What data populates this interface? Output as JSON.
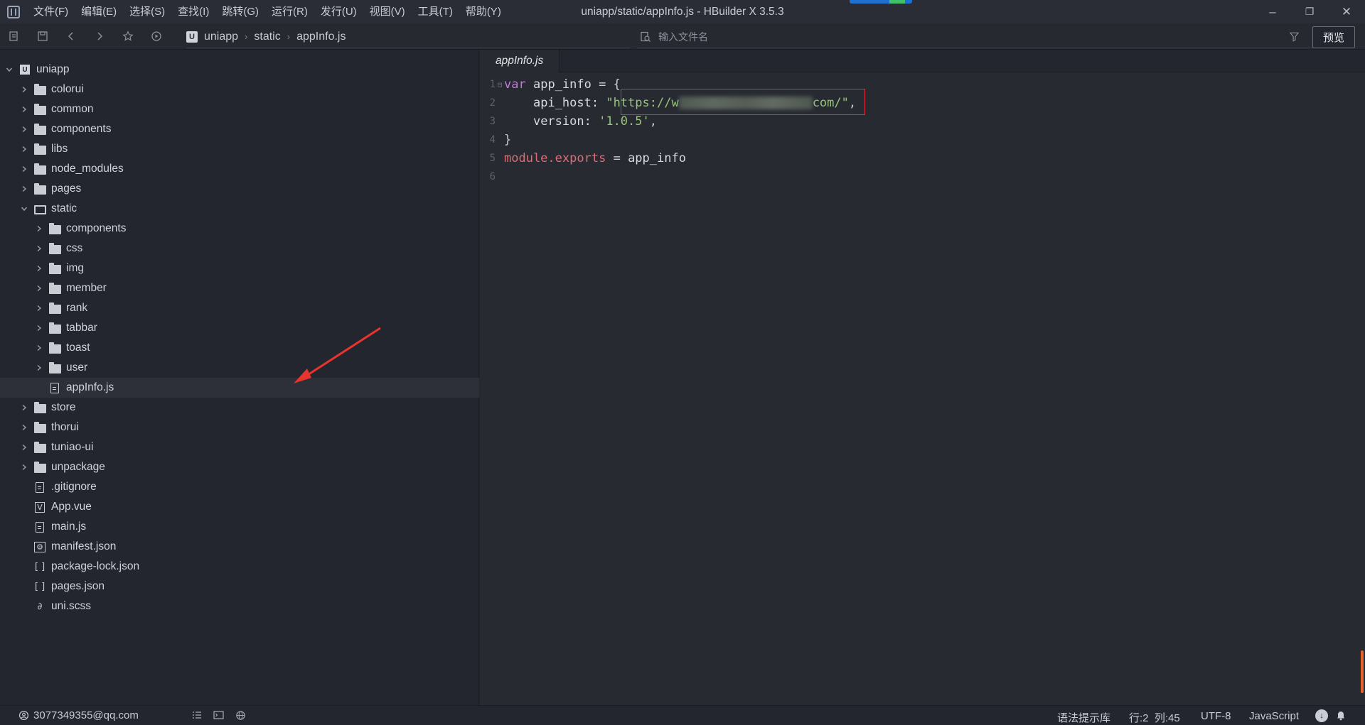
{
  "window": {
    "title": "uniapp/static/appInfo.js - HBuilder X 3.5.3",
    "menu": [
      "文件(F)",
      "编辑(E)",
      "选择(S)",
      "查找(I)",
      "跳转(G)",
      "运行(R)",
      "发行(U)",
      "视图(V)",
      "工具(T)",
      "帮助(Y)"
    ],
    "controls": {
      "minimize": "–",
      "maximize": "❐",
      "close": "✕"
    }
  },
  "toolbar": {
    "breadcrumb": [
      "uniapp",
      "static",
      "appInfo.js"
    ],
    "breadcrumb_logo": "U",
    "file_search_placeholder": "输入文件名",
    "preview_label": "预览"
  },
  "sidebar": {
    "root": "uniapp",
    "root_logo": "U",
    "items": [
      {
        "label": "colorui",
        "type": "folder"
      },
      {
        "label": "common",
        "type": "folder"
      },
      {
        "label": "components",
        "type": "folder"
      },
      {
        "label": "libs",
        "type": "folder"
      },
      {
        "label": "node_modules",
        "type": "folder"
      },
      {
        "label": "pages",
        "type": "folder"
      },
      {
        "label": "static",
        "type": "folder-open"
      },
      {
        "label": "components",
        "type": "folder"
      },
      {
        "label": "css",
        "type": "folder"
      },
      {
        "label": "img",
        "type": "folder"
      },
      {
        "label": "member",
        "type": "folder"
      },
      {
        "label": "rank",
        "type": "folder"
      },
      {
        "label": "tabbar",
        "type": "folder"
      },
      {
        "label": "toast",
        "type": "folder"
      },
      {
        "label": "user",
        "type": "folder"
      },
      {
        "label": "appInfo.js",
        "type": "file-js",
        "selected": true
      },
      {
        "label": "store",
        "type": "folder"
      },
      {
        "label": "thorui",
        "type": "folder"
      },
      {
        "label": "tuniao-ui",
        "type": "folder"
      },
      {
        "label": "unpackage",
        "type": "folder"
      },
      {
        "label": ".gitignore",
        "type": "file"
      },
      {
        "label": "App.vue",
        "type": "file-vue",
        "glyph": "V"
      },
      {
        "label": "main.js",
        "type": "file-js"
      },
      {
        "label": "manifest.json",
        "type": "file-manifest",
        "glyph": "⚙"
      },
      {
        "label": "package-lock.json",
        "type": "file-json",
        "glyph": "[ ]"
      },
      {
        "label": "pages.json",
        "type": "file-json",
        "glyph": "[ ]"
      },
      {
        "label": "uni.scss",
        "type": "file-scss",
        "glyph": "∂"
      }
    ]
  },
  "editor": {
    "tab": "appInfo.js",
    "line_numbers": [
      "1",
      "2",
      "3",
      "4",
      "5",
      "6"
    ],
    "code": {
      "l1_kw": "var",
      "l1_id": "app_info",
      "l1_rest": "= {",
      "l2_key": "api_host:",
      "l2_str_start": "\"https://w",
      "l2_str_end": "com/\"",
      "l2_comma": ",",
      "l3_key": "version:",
      "l3_str": "'1.0.5'",
      "l3_comma": ",",
      "l4": "}",
      "l5_obj": "module",
      "l5_prop": ".exports",
      "l5_op": "=",
      "l5_id": "app_info"
    }
  },
  "statusbar": {
    "account": "3077349355@qq.com",
    "syntax_lib": "语法提示库",
    "position": "行:2  列:45",
    "encoding": "UTF-8",
    "language": "JavaScript"
  },
  "colors": {
    "accent_red_box": "#e0303a",
    "annotation_arrow": "#e8342e",
    "keyword": "#c678dd",
    "string": "#98c379",
    "object": "#e06c75"
  }
}
